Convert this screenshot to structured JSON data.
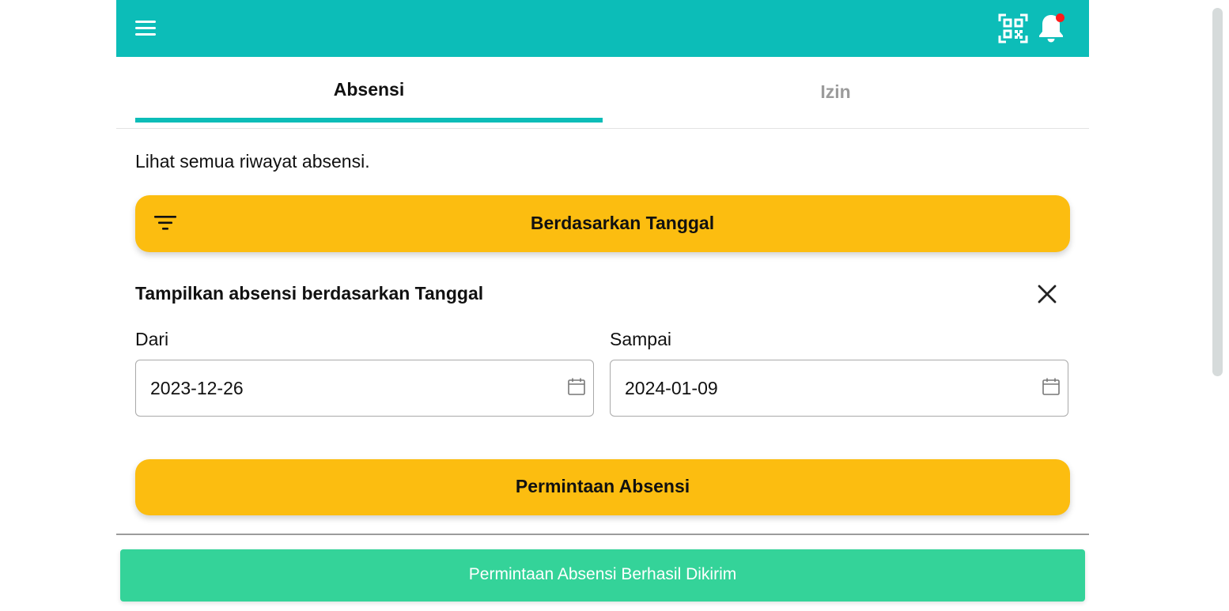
{
  "header": {
    "menu_icon": "hamburger-menu-icon",
    "qr_icon": "qr-scan-icon",
    "bell_icon": "bell-icon",
    "has_notification": true,
    "colors": {
      "bar": "#0cbdb8",
      "notification_dot": "#ff1b1b"
    }
  },
  "tabs": [
    {
      "label": "Absensi",
      "active": true
    },
    {
      "label": "Izin",
      "active": false
    }
  ],
  "description": "Lihat semua riwayat absensi.",
  "filter_button": {
    "label": "Berdasarkan Tanggal",
    "icon": "filter-icon"
  },
  "filter_panel": {
    "title": "Tampilkan absensi berdasarkan Tanggal",
    "close_icon": "close-icon",
    "from": {
      "label": "Dari",
      "value": "2023-12-26",
      "icon": "calendar-icon"
    },
    "to": {
      "label": "Sampai",
      "value": "2024-01-09",
      "icon": "calendar-icon"
    }
  },
  "submit_button": {
    "label": "Permintaan Absensi"
  },
  "toast": {
    "message": "Permintaan Absensi Berhasil Dikirim"
  },
  "colors": {
    "accent": "#0cbdb8",
    "button": "#fcbd10",
    "toast": "#34d399"
  }
}
